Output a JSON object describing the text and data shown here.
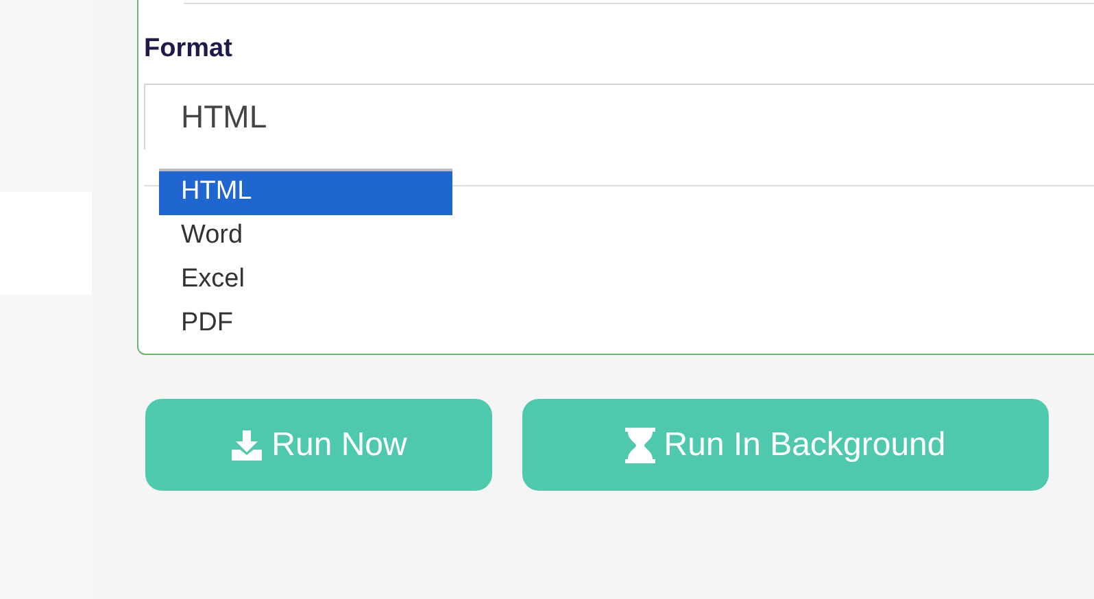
{
  "format_field": {
    "label": "Format",
    "value": "HTML",
    "expanded": true,
    "options": [
      {
        "label": "HTML",
        "selected": true
      },
      {
        "label": "Word",
        "selected": false
      },
      {
        "label": "Excel",
        "selected": false
      },
      {
        "label": "PDF",
        "selected": false
      }
    ]
  },
  "buttons": [
    {
      "label": "Run Now",
      "kind": "download"
    },
    {
      "label": "Run In Background",
      "kind": "hourglass"
    }
  ]
}
